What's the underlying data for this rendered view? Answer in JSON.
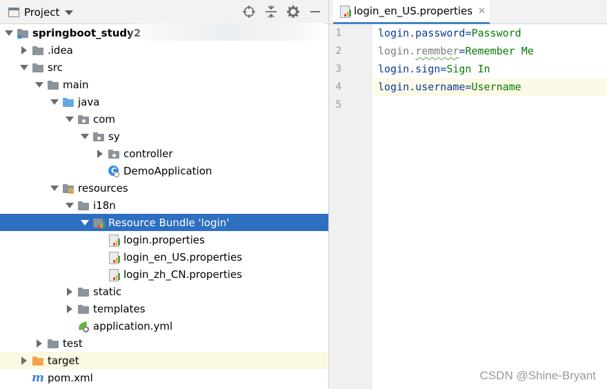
{
  "project_panel": {
    "title": "Project",
    "tree": [
      {
        "label": "springboot_study2",
        "depth": 0,
        "arrow": "down",
        "icon": "module-folder",
        "bold": true
      },
      {
        "label": ".idea",
        "depth": 1,
        "arrow": "right",
        "icon": "folder"
      },
      {
        "label": "src",
        "depth": 1,
        "arrow": "down",
        "icon": "folder"
      },
      {
        "label": "main",
        "depth": 2,
        "arrow": "down",
        "icon": "folder"
      },
      {
        "label": "java",
        "depth": 3,
        "arrow": "down",
        "icon": "source-folder"
      },
      {
        "label": "com",
        "depth": 4,
        "arrow": "down",
        "icon": "package"
      },
      {
        "label": "sy",
        "depth": 5,
        "arrow": "down",
        "icon": "package"
      },
      {
        "label": "controller",
        "depth": 6,
        "arrow": "right",
        "icon": "package"
      },
      {
        "label": "DemoApplication",
        "depth": 6,
        "arrow": "none",
        "icon": "class"
      },
      {
        "label": "resources",
        "depth": 3,
        "arrow": "down",
        "icon": "resources-folder"
      },
      {
        "label": "i18n",
        "depth": 4,
        "arrow": "down",
        "icon": "folder"
      },
      {
        "label": "Resource Bundle 'login'",
        "depth": 5,
        "arrow": "down",
        "icon": "resource-bundle",
        "selected": true
      },
      {
        "label": "login.properties",
        "depth": 6,
        "arrow": "none",
        "icon": "properties-file"
      },
      {
        "label": "login_en_US.properties",
        "depth": 6,
        "arrow": "none",
        "icon": "properties-file"
      },
      {
        "label": "login_zh_CN.properties",
        "depth": 6,
        "arrow": "none",
        "icon": "properties-file"
      },
      {
        "label": "static",
        "depth": 4,
        "arrow": "right",
        "icon": "folder"
      },
      {
        "label": "templates",
        "depth": 4,
        "arrow": "right",
        "icon": "folder"
      },
      {
        "label": "application.yml",
        "depth": 4,
        "arrow": "none",
        "icon": "yml-file"
      },
      {
        "label": "test",
        "depth": 2,
        "arrow": "right",
        "icon": "folder"
      },
      {
        "label": "target",
        "depth": 1,
        "arrow": "right",
        "icon": "excluded-folder",
        "highlight": true
      },
      {
        "label": "pom.xml",
        "depth": 1,
        "arrow": "none",
        "icon": "maven-file"
      }
    ]
  },
  "editor": {
    "tab_label": "login_en_US.properties",
    "lines": [
      {
        "num": "1",
        "key": "login.password",
        "value": "Password"
      },
      {
        "num": "2",
        "key": "login.remmber",
        "value": "Remember Me",
        "unused": true
      },
      {
        "num": "3",
        "key": "login.sign",
        "value": "Sign In"
      },
      {
        "num": "4",
        "key": "login.username",
        "value": "Username",
        "current": true
      },
      {
        "num": "5",
        "key": "",
        "value": ""
      }
    ]
  },
  "watermark": "CSDN @Shine-Bryant",
  "colors": {
    "selection": "#2e6fc0",
    "key": "#0a3a9a",
    "value": "#077a07",
    "current_line": "#fcfae6"
  }
}
